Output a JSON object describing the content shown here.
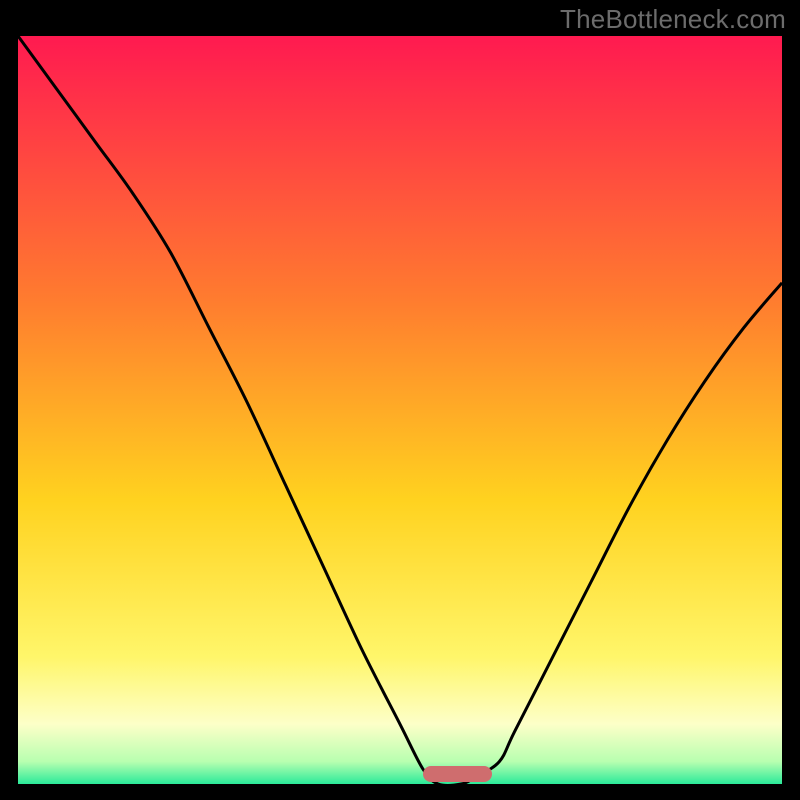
{
  "watermark": "TheBottleneck.com",
  "colors": {
    "gradient_top": "#ff1a50",
    "gradient_mid1": "#ff7b2f",
    "gradient_mid2": "#ffd21f",
    "gradient_mid3": "#fff66a",
    "gradient_mid4": "#fdffc8",
    "gradient_green1": "#b8ffb0",
    "gradient_green2": "#2bea9a",
    "curve_stroke": "#000000",
    "marker_fill": "#cf6d6e",
    "frame_border": "#000000"
  },
  "chart_data": {
    "type": "line",
    "title": "",
    "xlabel": "",
    "ylabel": "",
    "xlim": [
      0,
      100
    ],
    "ylim": [
      0,
      100
    ],
    "notes": "Bottleneck-style V-curve. Y is mismatch percentage (0 = no bottleneck at bottom, 100 = severe at top). No numeric axis labels visible; values are pixel-estimated from the curve against the frame.",
    "series": [
      {
        "name": "bottleneck-curve",
        "x": [
          0,
          5,
          10,
          15,
          20,
          25,
          30,
          35,
          40,
          45,
          50,
          53,
          55,
          58,
          60,
          63,
          65,
          70,
          75,
          80,
          85,
          90,
          95,
          100
        ],
        "y": [
          100,
          93,
          86,
          79,
          71,
          61,
          51,
          40,
          29,
          18,
          8,
          2,
          0,
          0,
          1,
          3,
          7,
          17,
          27,
          37,
          46,
          54,
          61,
          67
        ]
      }
    ],
    "marker": {
      "name": "optimal-range",
      "x_start": 53,
      "x_end": 62,
      "y": 0
    }
  }
}
